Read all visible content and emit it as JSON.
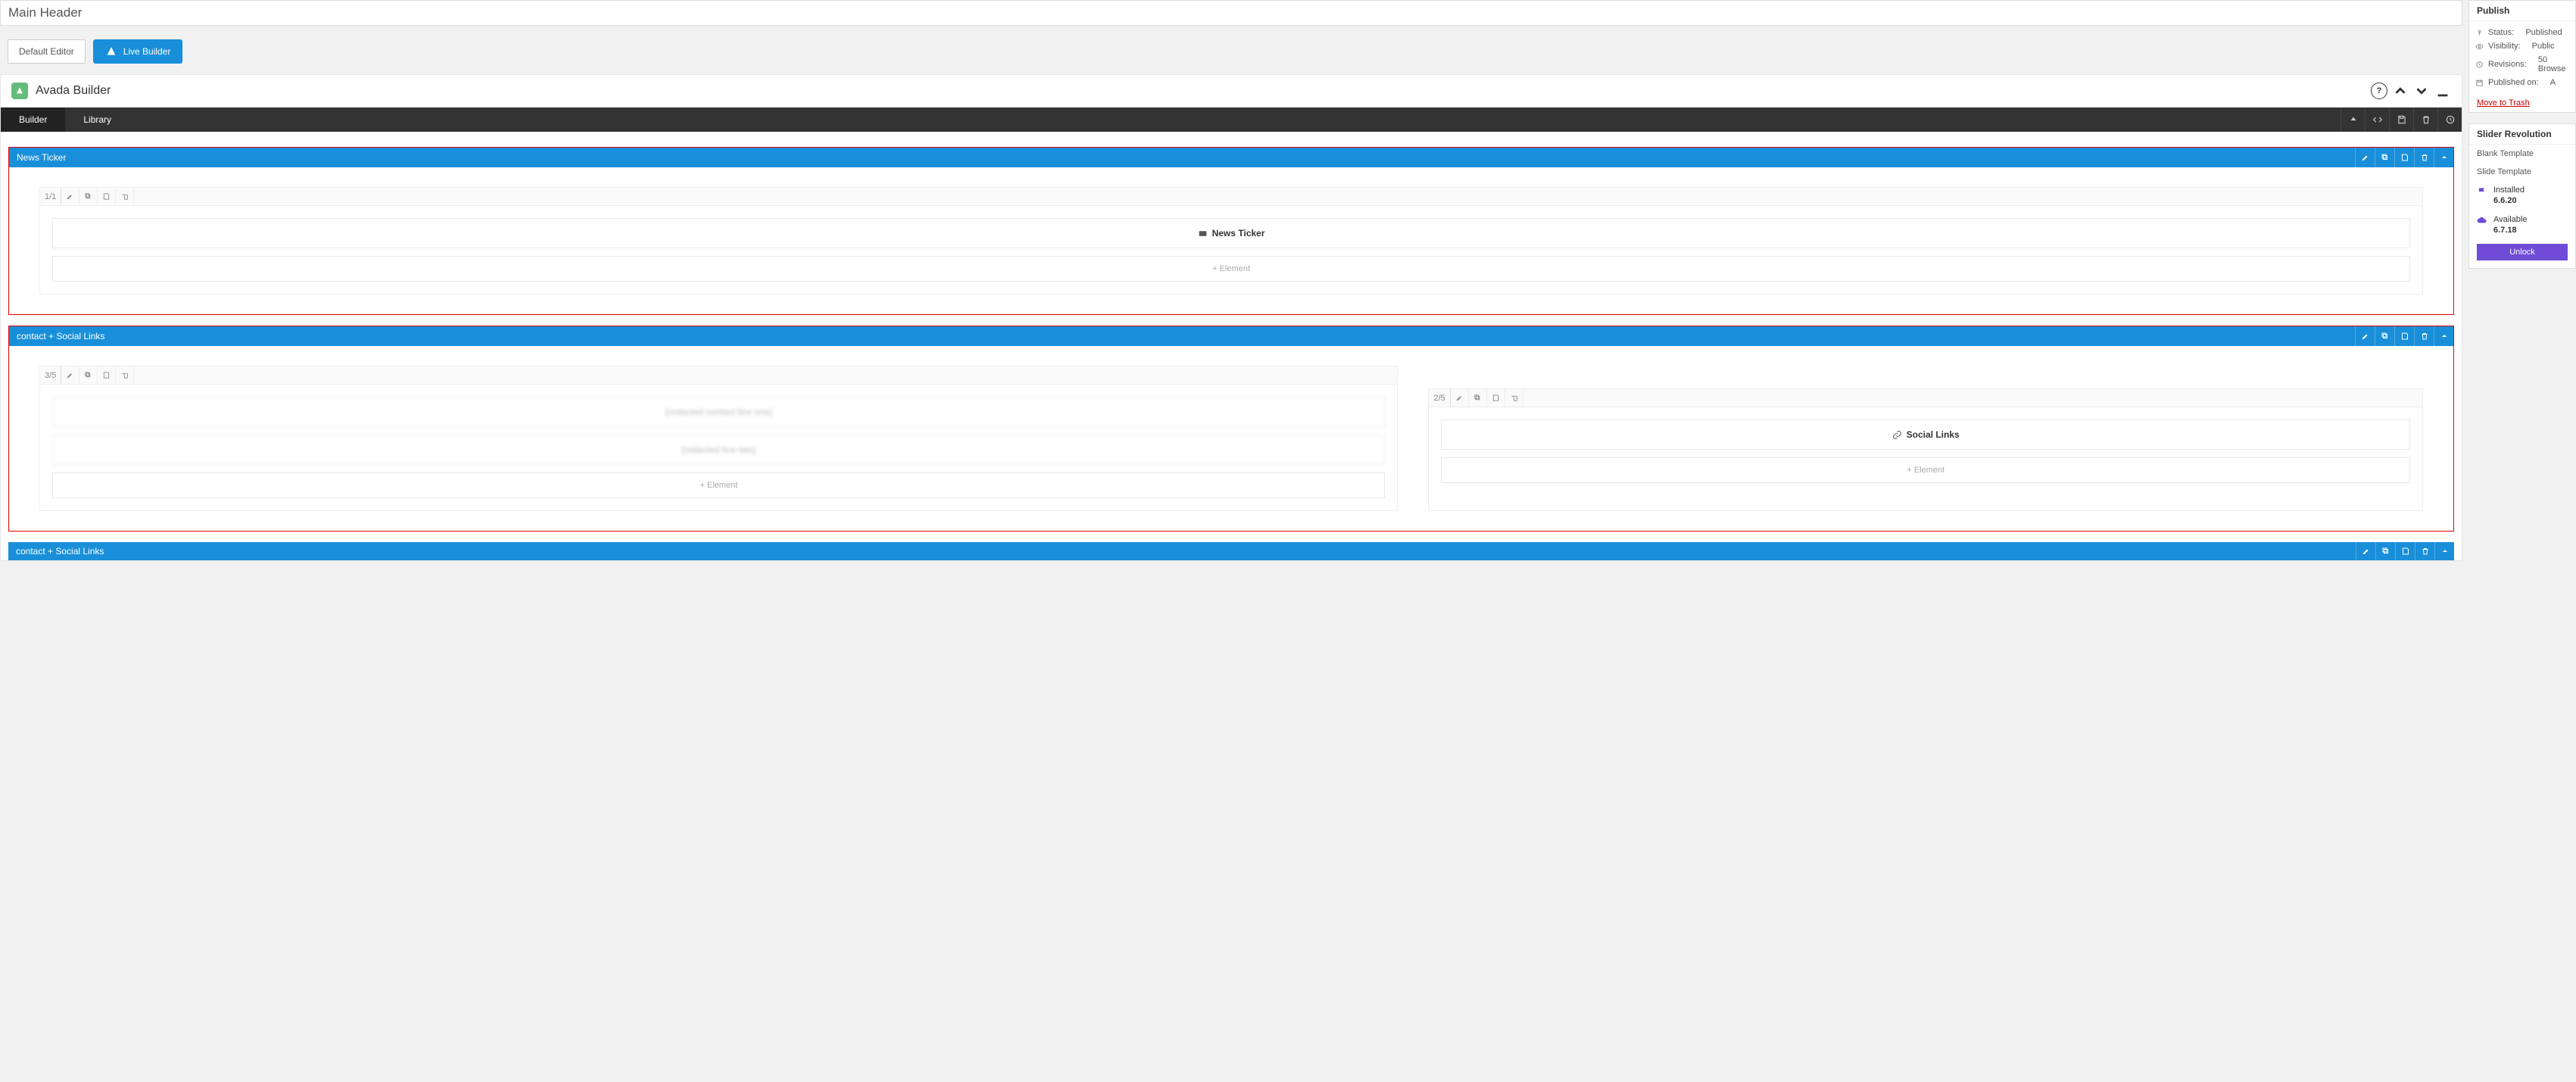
{
  "title_value": "Main Header",
  "editor_buttons": {
    "default": "Default Editor",
    "live": "Live Builder"
  },
  "builder": {
    "name": "Avada Builder"
  },
  "tabs": {
    "builder": "Builder",
    "library": "Library"
  },
  "containers": [
    {
      "title": "News Ticker",
      "columns": [
        {
          "fraction": "1/1",
          "elements": [
            {
              "label": "News Ticker",
              "icon": "card"
            }
          ],
          "add_label": "Element"
        }
      ]
    },
    {
      "title": "contact + Social Links",
      "columns": [
        {
          "fraction": "3/5",
          "elements": [
            {
              "blur": true,
              "text": "[redacted contact line one]"
            },
            {
              "blur": true,
              "text": "[redacted line two]"
            }
          ],
          "add_label": "Element"
        },
        {
          "fraction": "2/5",
          "elements": [
            {
              "label": "Social Links",
              "icon": "link"
            }
          ],
          "add_label": "Element"
        }
      ]
    }
  ],
  "bottom_container_title": "contact + Social Links",
  "publish": {
    "title": "Publish",
    "status_label": "Status:",
    "status_value": "Published",
    "visibility_label": "Visibility:",
    "visibility_value": "Public",
    "revisions_label": "Revisions:",
    "revisions_value": "50 Browse",
    "published_label": "Published on:",
    "published_value": "A",
    "trash": "Move to Trash"
  },
  "slider": {
    "title": "Slider Revolution",
    "blank": "Blank Template",
    "slide": "Slide Template",
    "installed_label": "Installed",
    "installed_ver": "6.6.20",
    "available_label": "Available",
    "available_ver": "6.7.18",
    "unlock": "Unlock"
  }
}
